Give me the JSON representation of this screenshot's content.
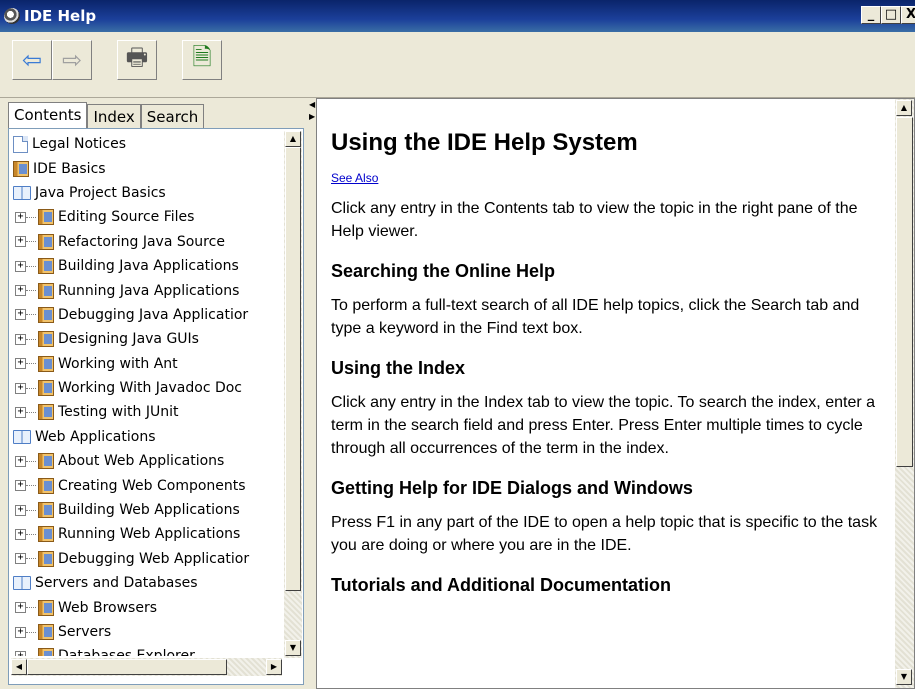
{
  "window": {
    "title": "IDE Help",
    "controls": [
      "_",
      "□",
      "X"
    ]
  },
  "toolbar": {
    "buttons": [
      {
        "name": "back",
        "icon": "back-arrow-icon",
        "glyph": "⇦"
      },
      {
        "name": "forward",
        "icon": "forward-arrow-icon",
        "glyph": "⇨"
      },
      {
        "name": "print",
        "icon": "printer-icon",
        "glyph": "🖶"
      },
      {
        "name": "page-setup",
        "icon": "page-setup-icon",
        "glyph": "🗎"
      }
    ]
  },
  "tabs": [
    "Contents",
    "Index",
    "Search"
  ],
  "tree": [
    {
      "label": "Legal Notices",
      "icon": "page",
      "level": 0,
      "expander": false
    },
    {
      "label": "IDE Basics",
      "icon": "book",
      "level": 0,
      "expander": false
    },
    {
      "label": "Java Project Basics",
      "icon": "openbook",
      "level": 0,
      "expander": false
    },
    {
      "label": "Editing Source Files",
      "icon": "book",
      "level": 1,
      "expander": true
    },
    {
      "label": "Refactoring Java Source",
      "icon": "book",
      "level": 1,
      "expander": true
    },
    {
      "label": "Building Java Applications",
      "icon": "book",
      "level": 1,
      "expander": true
    },
    {
      "label": "Running Java Applications",
      "icon": "book",
      "level": 1,
      "expander": true
    },
    {
      "label": "Debugging Java Applicatior",
      "icon": "book",
      "level": 1,
      "expander": true
    },
    {
      "label": "Designing Java GUIs",
      "icon": "book",
      "level": 1,
      "expander": true
    },
    {
      "label": "Working with Ant",
      "icon": "book",
      "level": 1,
      "expander": true
    },
    {
      "label": "Working With Javadoc Doc",
      "icon": "book",
      "level": 1,
      "expander": true
    },
    {
      "label": "Testing with JUnit",
      "icon": "book",
      "level": 1,
      "expander": true
    },
    {
      "label": "Web Applications",
      "icon": "openbook",
      "level": 0,
      "expander": false
    },
    {
      "label": "About Web Applications",
      "icon": "book",
      "level": 1,
      "expander": true
    },
    {
      "label": "Creating Web Components",
      "icon": "book",
      "level": 1,
      "expander": true
    },
    {
      "label": "Building Web Applications",
      "icon": "book",
      "level": 1,
      "expander": true
    },
    {
      "label": "Running Web Applications",
      "icon": "book",
      "level": 1,
      "expander": true
    },
    {
      "label": "Debugging Web Applicatior",
      "icon": "book",
      "level": 1,
      "expander": true
    },
    {
      "label": "Servers and Databases",
      "icon": "openbook",
      "level": 0,
      "expander": false
    },
    {
      "label": "Web Browsers",
      "icon": "book",
      "level": 1,
      "expander": true
    },
    {
      "label": "Servers",
      "icon": "book",
      "level": 1,
      "expander": true
    },
    {
      "label": "Databases Explorer",
      "icon": "book",
      "level": 1,
      "expander": true
    }
  ],
  "content": {
    "title": "Using the IDE Help System",
    "see_also": "See Also",
    "intro": "Click any entry in the Contents tab to view the topic in the right pane of the Help viewer.",
    "sections": [
      {
        "heading": "Searching the Online Help",
        "body": "To perform a full-text search of all IDE help topics, click the Search tab and type a keyword in the Find text box."
      },
      {
        "heading": "Using the Index",
        "body": "Click any entry in the Index tab to view the topic. To search the index, enter a term in the search field and press Enter. Press Enter multiple times to cycle through all occurrences of the term in the index."
      },
      {
        "heading": "Getting Help for IDE Dialogs and Windows",
        "body": "Press F1 in any part of the IDE to open a help topic that is specific to the task you are doing or where you are in the IDE."
      },
      {
        "heading": "Tutorials and Additional Documentation",
        "body": ""
      }
    ]
  },
  "colors": {
    "titlebar": "#0a246a",
    "link": "#0000cc",
    "chrome": "#ece9d8"
  }
}
